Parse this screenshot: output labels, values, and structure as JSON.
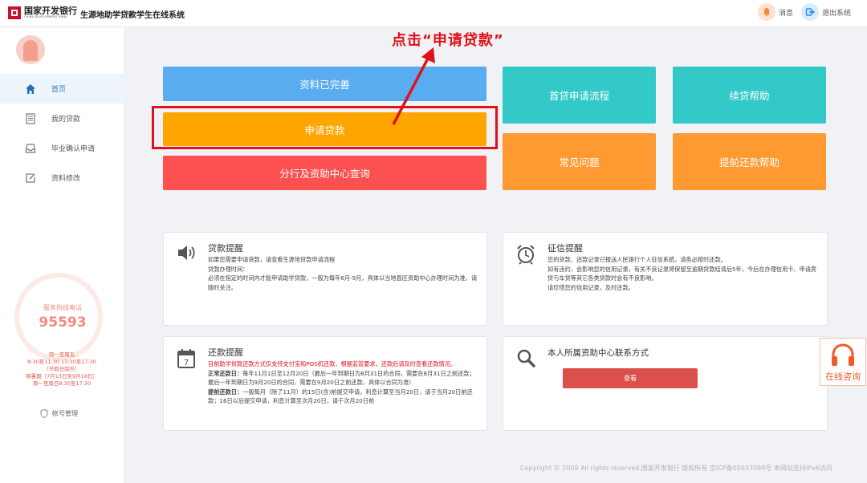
{
  "header": {
    "bank_name": "国家开发银行",
    "bank_name_en": "CHINA DEVELOPMENT BANK",
    "system_title": "生源地助学贷款学生在线系统",
    "message_label": "消息",
    "logout_label": "退出系统"
  },
  "sidebar": {
    "items": [
      {
        "label": "首页",
        "icon": "home-icon",
        "active": true
      },
      {
        "label": "我的贷款",
        "icon": "document-icon"
      },
      {
        "label": "毕业确认申请",
        "icon": "inbox-icon"
      },
      {
        "label": "资料修改",
        "icon": "edit-icon"
      }
    ],
    "hotline_label": "服务热线电话",
    "hotline_number": "95593",
    "hours": [
      "周一至周五",
      "8:30至11:30 13:30至17:30",
      "（节假日除外）",
      "寒暑期（7月13日至9月18日）",
      "周一至周日8:30至17:30"
    ],
    "account_label": "帐号管理"
  },
  "actions": {
    "complete": "资料已完善",
    "apply": "申请贷款",
    "branch_query": "分行及资助中心查询",
    "apply_flow": "首贷申请流程",
    "renew_help": "续贷帮助",
    "faq": "常见问题",
    "prepay_help": "提前还款帮助"
  },
  "annotation": {
    "text": "点击“申请贷款”"
  },
  "cards": {
    "loan_reminder": {
      "title": "贷款提醒",
      "lines": [
        "如果您需要申请贷款，请查看生源地贷款申请流程",
        "贷款办理时间：",
        "必须在指定的时间内才能申请助学贷款，一般为每年6月-9月，具体以当地县区资助中心办理时间为准，请随时关注。"
      ]
    },
    "credit_reminder": {
      "title": "征信提醒",
      "lines": [
        "您的贷款、还款记录已报送人民银行个人征信系统，请务必按时还款。",
        "如有违约，会影响您的信用记录，有关不良记录将保留至逾期贷款结清后5年，今后在办理信用卡、申请房贷与车贷等其它各类贷款时会有不良影响。",
        "请珍惜您的信用记录，及时还款。"
      ]
    },
    "repay_reminder": {
      "title": "还款提醒",
      "notice": "目前助学贷款还款方式仅支持支付宝和POS机还款，根据监管要求，还款后请及时查看还款情况。",
      "normal_label": "正常还款日：",
      "normal_text": "每年11月1日至12月20日（最后一年到期日为8月31日的合同，需要在8月31日之前还款；最后一年到期日为9月20日的合同，需要在9月20日之前还款，具体以合同为准）",
      "early_label": "提前还款日：",
      "early_text": "一般每月（除了11月）的15日(含)前提交申请，利息计算至当月20日，请于当月20日前还款；16日以后提交申请，利息计算至次月20日，请于次月20日前"
    },
    "center_contact": {
      "title": "本人所属资助中心联系方式",
      "button": "查看"
    }
  },
  "consult_label": "在线咨询",
  "footer": "Copyright © 2009 All rights reserved.国家开发银行 版权所有 京ICP备05037088号 本网站支持IPv6访问",
  "colors": {
    "blue": "#5aacf0",
    "orange": "#ffa500",
    "red": "#fd5050",
    "teal": "#33c9c9",
    "light_orange": "#ff9a33",
    "highlight_red": "#e0111a"
  }
}
